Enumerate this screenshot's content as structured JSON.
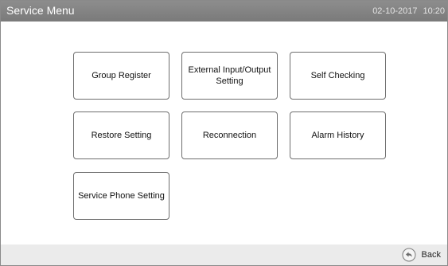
{
  "header": {
    "title": "Service Menu",
    "date": "02-10-2017",
    "time": "10:20"
  },
  "menu": {
    "group_register": "Group Register",
    "external_io_line1": "External Input/Output",
    "external_io_line2": "Setting",
    "self_checking": "Self Checking",
    "restore_setting": "Restore Setting",
    "reconnection": "Reconnection",
    "alarm_history": "Alarm History",
    "service_phone_setting": "Service Phone Setting"
  },
  "footer": {
    "back_label": "Back",
    "back_icon": "back-arrow-icon"
  },
  "colors": {
    "titlebar": "#858585",
    "footer": "#ebebeb",
    "button_border": "#6e6e6e"
  }
}
